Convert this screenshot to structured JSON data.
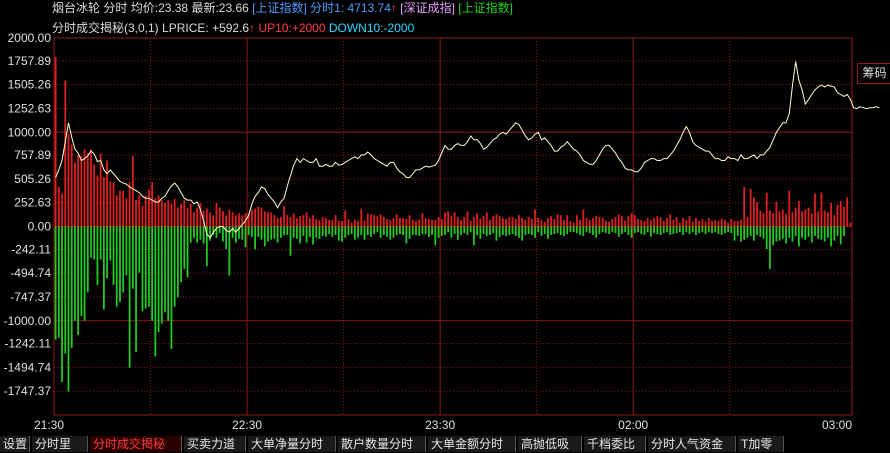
{
  "header": {
    "stock": "烟台冰轮",
    "mode": "分时",
    "avg_label": "均价:",
    "avg_value": "23.38",
    "latest_label": "最新:",
    "latest_value": "23.66",
    "index1": "[上证指数]",
    "fen_label": "分时1:",
    "fen_value": "4713.74",
    "up_arrow": "↑",
    "index2": "[深证成指]",
    "index3": "[上证指数]"
  },
  "indicator": {
    "name": "分时成交揭秘(3,0,1)",
    "lprice_label": "LPRICE:",
    "lprice_value": "+592.6",
    "arrow": "↑",
    "up_label": "UP10:",
    "up_value": "+2000",
    "down_label": "DOWN10:",
    "down_value": "-2000"
  },
  "side_tab": "筹码",
  "tabs": [
    "设置",
    "分时里",
    "分时成交揭秘",
    "买卖力道",
    "大单净量分时",
    "散户数量分时",
    "大单金额分时",
    "高抛低吸",
    "千档委比",
    "分时人气资金",
    "T加零"
  ],
  "active_tab": 2,
  "colors": {
    "background": "#000000",
    "grid": "#8b1a1a",
    "positive_bar": "#e02020",
    "negative_bar": "#22cc22",
    "price_line": "#ffffcc",
    "axis_text": "#e0e0e0"
  },
  "chart_data": {
    "type": "bar",
    "title": "分时成交揭秘(3,0,1)",
    "y_ticks": [
      "2000.00",
      "1757.89",
      "1505.26",
      "1252.63",
      "1000.00",
      "757.89",
      "505.26",
      "252.63",
      "0.00",
      "-242.11",
      "-494.74",
      "-747.37",
      "-1000.00",
      "-1242.11",
      "-1494.74",
      "-1747.37"
    ],
    "ylim": [
      -2000,
      2000
    ],
    "x_ticks": [
      "21:30",
      "22:30",
      "23:30",
      "02:00",
      "03:00"
    ],
    "x_tick_index": [
      0,
      60,
      120,
      180,
      240
    ],
    "grid": true,
    "series": [
      {
        "name": "UP",
        "color": "#e02020",
        "values": [
          1800,
          420,
          350,
          1550,
          980,
          870,
          680,
          760,
          750,
          820,
          780,
          820,
          660,
          540,
          770,
          520,
          700,
          480,
          470,
          330,
          380,
          380,
          300,
          470,
          750,
          280,
          330,
          220,
          330,
          390,
          470,
          300,
          330,
          280,
          250,
          280,
          240,
          290,
          200,
          240,
          280,
          200,
          240,
          150,
          200,
          250,
          170,
          190,
          150,
          120,
          250,
          200,
          160,
          120,
          180,
          150,
          120,
          140,
          120,
          140,
          140,
          180,
          190,
          210,
          200,
          160,
          150,
          150,
          120,
          90,
          100,
          220,
          120,
          100,
          140,
          90,
          110,
          120,
          150,
          90,
          120,
          80,
          70,
          100,
          90,
          70,
          70,
          120,
          60,
          60,
          170,
          80,
          40,
          70,
          60,
          190,
          60,
          140,
          130,
          120,
          110,
          130,
          100,
          80,
          70,
          90,
          130,
          90,
          90,
          80,
          120,
          70,
          60,
          70,
          140,
          90,
          80,
          70,
          70,
          100,
          80,
          150,
          160,
          110,
          150,
          100,
          70,
          100,
          160,
          60,
          100,
          140,
          80,
          110,
          150,
          70,
          110,
          130,
          110,
          90,
          80,
          100,
          100,
          80,
          120,
          90,
          70,
          100,
          80,
          180,
          90,
          70,
          50,
          90,
          110,
          80,
          130,
          120,
          70,
          120,
          60,
          40,
          120,
          70,
          180,
          90,
          70,
          90,
          110,
          100,
          90,
          60,
          50,
          80,
          100,
          130,
          110,
          60,
          110,
          140,
          120,
          80,
          70,
          60,
          90,
          70,
          90,
          110,
          100,
          60,
          90,
          130,
          70,
          100,
          40,
          90,
          70,
          110,
          50,
          90,
          60,
          80,
          50,
          90,
          60,
          70,
          60,
          80,
          70,
          40,
          80,
          60,
          60,
          70,
          420,
          100,
          400,
          310,
          260,
          170,
          140,
          360,
          170,
          140,
          260,
          160,
          180,
          130,
          380,
          150,
          200,
          270,
          160,
          180,
          200,
          140,
          350,
          160,
          360,
          170,
          150,
          250,
          120,
          230,
          270,
          210,
          310,
          40
        ]
      },
      {
        "name": "DOWN",
        "color": "#22cc22",
        "values": [
          -1200,
          -1180,
          -1650,
          -1350,
          -1750,
          -1290,
          -1000,
          -1150,
          -950,
          -1000,
          -700,
          -330,
          -350,
          -620,
          -350,
          -880,
          -550,
          -360,
          -620,
          -850,
          -800,
          -700,
          -520,
          -1500,
          -660,
          -1330,
          -490,
          -900,
          -870,
          -850,
          -1000,
          -1380,
          -1120,
          -1030,
          -910,
          -1000,
          -1300,
          -850,
          -750,
          -590,
          -450,
          -540,
          -170,
          -120,
          -170,
          -140,
          -180,
          -420,
          -150,
          -90,
          -120,
          -70,
          -160,
          -240,
          -520,
          -120,
          -170,
          -130,
          -140,
          -220,
          -90,
          -110,
          -240,
          -110,
          -140,
          -210,
          -160,
          -140,
          -130,
          -170,
          -120,
          -90,
          -90,
          -310,
          -120,
          -130,
          -180,
          -100,
          -170,
          -110,
          -190,
          -120,
          -130,
          -100,
          -110,
          -80,
          -110,
          -90,
          -150,
          -160,
          -120,
          -90,
          -80,
          -140,
          -120,
          -90,
          -140,
          -90,
          -110,
          -80,
          -60,
          -120,
          -90,
          -110,
          -140,
          -120,
          -90,
          -80,
          -90,
          -180,
          -130,
          -90,
          -90,
          -100,
          -80,
          -80,
          -110,
          -90,
          -200,
          -120,
          -100,
          -90,
          -60,
          -120,
          -80,
          -140,
          -90,
          -70,
          -90,
          -60,
          -200,
          -90,
          -130,
          -80,
          -100,
          -90,
          -70,
          -150,
          -110,
          -90,
          -100,
          -90,
          -80,
          -100,
          -120,
          -150,
          -90,
          -80,
          -90,
          -120,
          -60,
          -100,
          -80,
          -130,
          -90,
          -80,
          -70,
          -90,
          -100,
          -80,
          -60,
          -60,
          -70,
          -90,
          -100,
          -60,
          -70,
          -90,
          -120,
          -80,
          -60,
          -70,
          -80,
          -60,
          -70,
          -110,
          -80,
          -60,
          -90,
          -120,
          -70,
          -60,
          -80,
          -90,
          -60,
          -110,
          -70,
          -80,
          -90,
          -70,
          -60,
          -90,
          -80,
          -70,
          -60,
          -90,
          -60,
          -80,
          -60,
          -90,
          -70,
          -60,
          -80,
          -60,
          -70,
          -60,
          -80,
          -90,
          -70,
          -60,
          -70,
          -150,
          -100,
          -160,
          -140,
          -120,
          -100,
          -150,
          -90,
          -110,
          -130,
          -240,
          -450,
          -200,
          -160,
          -150,
          -130,
          -180,
          -120,
          -160,
          -100,
          -210,
          -120,
          -140,
          -110,
          -170,
          -100,
          -130,
          -140,
          -160,
          -120,
          -210,
          -150,
          -100,
          -190,
          -100
        ]
      },
      {
        "name": "LPRICE",
        "color": "#ffffcc",
        "values": [
          520,
          600,
          700,
          900,
          1100,
          950,
          820,
          780,
          700,
          720,
          750,
          800,
          770,
          690,
          700,
          600,
          560,
          600,
          560,
          520,
          480,
          460,
          450,
          420,
          400,
          380,
          360,
          320,
          300,
          300,
          280,
          260,
          260,
          300,
          320,
          380,
          430,
          460,
          420,
          360,
          300,
          280,
          280,
          240,
          260,
          180,
          60,
          -80,
          -120,
          -60,
          -20,
          0,
          0,
          -40,
          -60,
          -20,
          -60,
          -20,
          20,
          60,
          120,
          240,
          320,
          360,
          420,
          400,
          340,
          300,
          260,
          200,
          260,
          300,
          430,
          540,
          650,
          720,
          680,
          720,
          700,
          680,
          680,
          720,
          640,
          640,
          660,
          640,
          640,
          680,
          650,
          660,
          680,
          700,
          720,
          740,
          720,
          760,
          760,
          790,
          760,
          720,
          700,
          680,
          660,
          640,
          680,
          680,
          620,
          580,
          560,
          520,
          520,
          560,
          600,
          600,
          620,
          640,
          630,
          640,
          650,
          700,
          780,
          860,
          820,
          820,
          860,
          880,
          860,
          860,
          900,
          960,
          920,
          920,
          880,
          820,
          840,
          880,
          920,
          940,
          980,
          1000,
          980,
          1020,
          1060,
          1100,
          1080,
          1020,
          960,
          920,
          940,
          980,
          1000,
          920,
          940,
          900,
          860,
          800,
          800,
          840,
          860,
          900,
          860,
          820,
          800,
          760,
          700,
          680,
          660,
          660,
          700,
          760,
          820,
          860,
          860,
          820,
          780,
          720,
          680,
          620,
          600,
          600,
          580,
          580,
          620,
          680,
          700,
          720,
          720,
          700,
          700,
          720,
          720,
          760,
          800,
          860,
          920,
          1000,
          1060,
          1000,
          900,
          860,
          840,
          820,
          800,
          800,
          760,
          720,
          720,
          700,
          700,
          740,
          720,
          720,
          700,
          760,
          720,
          720,
          740,
          760,
          720,
          760,
          760,
          800,
          840,
          920,
          1000,
          1050,
          1100,
          1100,
          1200,
          1500,
          1750,
          1550,
          1450,
          1300,
          1350,
          1400,
          1450,
          1480,
          1500,
          1480,
          1500,
          1490,
          1480,
          1420,
          1400,
          1380,
          1400,
          1350,
          1260,
          1250,
          1270,
          1260,
          1250,
          1260,
          1260,
          1270,
          1260
        ]
      }
    ]
  }
}
